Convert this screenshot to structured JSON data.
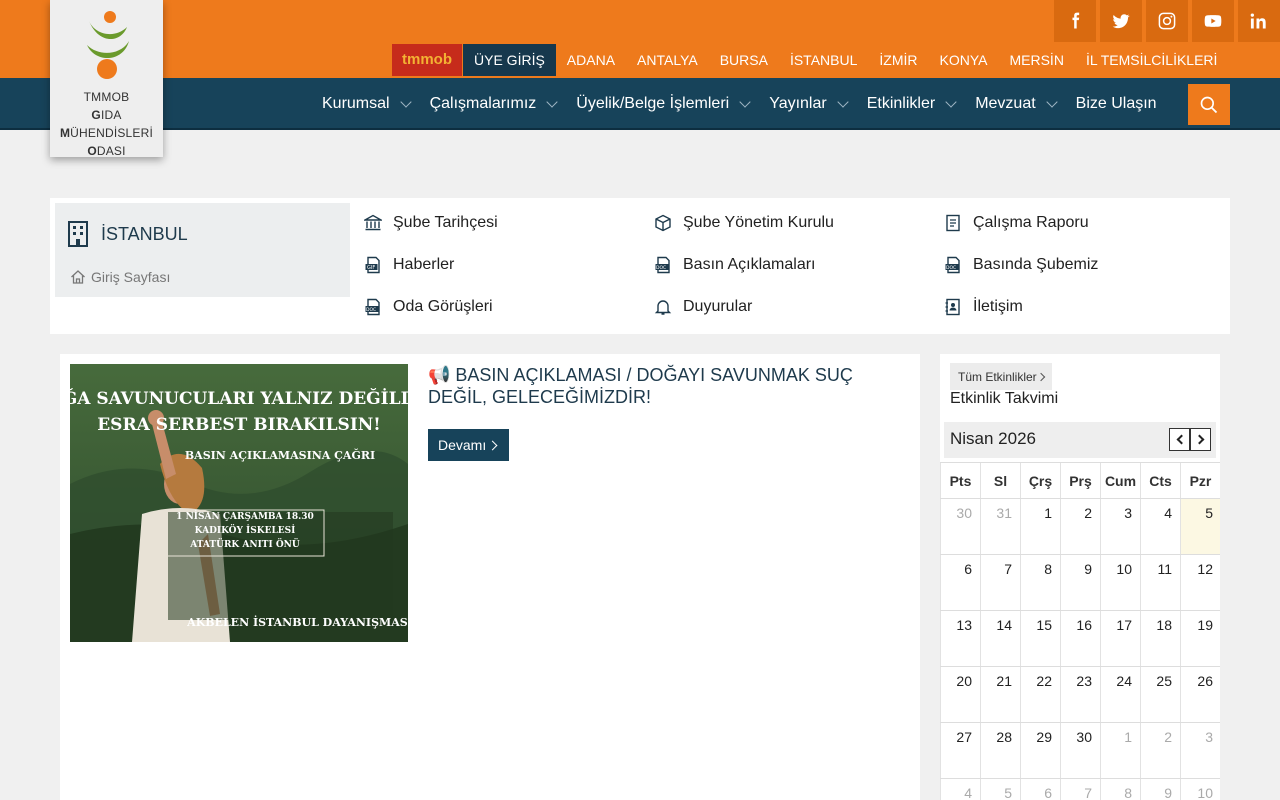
{
  "social": [
    "facebook-icon",
    "twitter-icon",
    "instagram-icon",
    "youtube-icon",
    "linkedin-icon"
  ],
  "toplinks": {
    "tmmob": "tmmob",
    "member_login": "ÜYE GİRİŞ",
    "cities": [
      "ADANA",
      "ANTALYA",
      "BURSA",
      "İSTANBUL",
      "İZMİR",
      "KONYA",
      "MERSİN",
      "İL TEMSİLCİLİKLERİ"
    ]
  },
  "nav": {
    "items": [
      "Kurumsal",
      "Çalışmalarımız",
      "Üyelik/Belge İşlemleri",
      "Yayınlar",
      "Etkinlikler",
      "Mevzuat"
    ],
    "contact": "Bize Ulaşın"
  },
  "logo": {
    "line1": "TMMOB",
    "line2_first": "G",
    "line2_rest": "IDA",
    "line3_first": "M",
    "line3_rest": "ÜHENDİSLERİ",
    "line4_first": "O",
    "line4_rest": "DASI"
  },
  "section": {
    "title": "İSTANBUL",
    "home": "Giriş Sayfası",
    "links": [
      {
        "label": "Şube Tarihçesi",
        "icon": "bank-icon"
      },
      {
        "label": "Şube Yönetim Kurulu",
        "icon": "cube-icon"
      },
      {
        "label": "Çalışma Raporu",
        "icon": "document-icon"
      },
      {
        "label": "Haberler",
        "icon": "gif-file-icon"
      },
      {
        "label": "Basın Açıklamaları",
        "icon": "docx-file-icon"
      },
      {
        "label": "Basında Şubemiz",
        "icon": "docx-file-icon"
      },
      {
        "label": "Oda Görüşleri",
        "icon": "docx-file-icon"
      },
      {
        "label": "Duyurular",
        "icon": "bell-icon"
      },
      {
        "label": "İletişim",
        "icon": "contact-book-icon"
      }
    ]
  },
  "article": {
    "title": "📢 BASIN AÇIKLAMASI / DOĞAYI SAVUNMAK SUÇ DEĞİL, GELECEĞİMİZDİR!",
    "more": "Devamı",
    "poster": {
      "line1": "DOĞA SAVUNUCULARI YALNIZ DEĞİLDİR!",
      "line2": "ESRA SERBEST BIRAKILSIN!",
      "line3": "BASIN AÇIKLAMASINA ÇAĞRI",
      "info1": "1 NİSAN ÇARŞAMBA 18.30",
      "info2": "KADIKÖY İSKELESİ",
      "info3": "ATATÜRK ANITI ÖNÜ",
      "footer": "AKBELEN İSTANBUL DAYANIŞMASI"
    }
  },
  "calendar": {
    "all_events": "Tüm Etkinlikler",
    "title": "Etkinlik Takvimi",
    "month": "Nisan 2026",
    "weekdays": [
      "Pts",
      "Sl",
      "Çrş",
      "Prş",
      "Cum",
      "Cts",
      "Pzr"
    ],
    "weeks": [
      [
        "30",
        "31",
        "1",
        "2",
        "3",
        "4",
        "5"
      ],
      [
        "6",
        "7",
        "8",
        "9",
        "10",
        "11",
        "12"
      ],
      [
        "13",
        "14",
        "15",
        "16",
        "17",
        "18",
        "19"
      ],
      [
        "20",
        "21",
        "22",
        "23",
        "24",
        "25",
        "26"
      ],
      [
        "27",
        "28",
        "29",
        "30",
        "1",
        "2",
        "3"
      ],
      [
        "4",
        "5",
        "6",
        "7",
        "8",
        "9",
        "10"
      ]
    ],
    "today": "5",
    "accent_color": "#fcf8e3"
  },
  "colors": {
    "orange": "#ee7a1c",
    "navy": "#17435a",
    "tmmob_red": "#c62b1b"
  }
}
